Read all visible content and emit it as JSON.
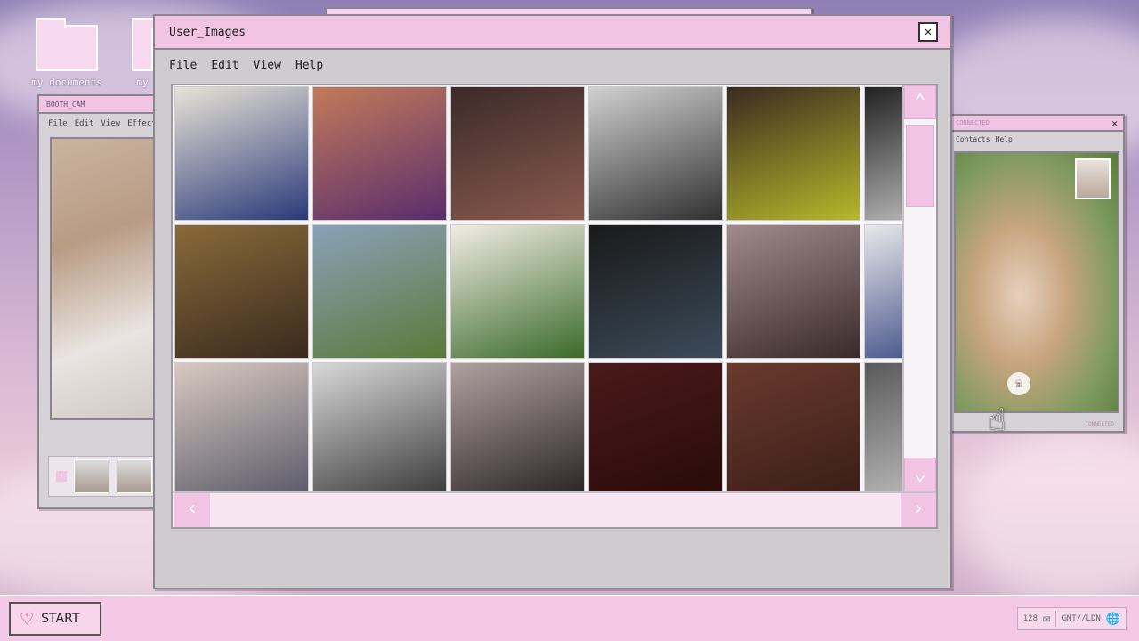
{
  "desktop": {
    "icons": [
      {
        "label": "my documents"
      },
      {
        "label": "my"
      }
    ]
  },
  "booth_window": {
    "title": "BOOTH_CAM",
    "menu": [
      "File",
      "Edit",
      "View",
      "Effects"
    ]
  },
  "contacts_window": {
    "title": "CONNECTED",
    "menu": [
      "Contacts",
      "Help"
    ],
    "status": "CONNECTED"
  },
  "main_window": {
    "title": "User_Images",
    "menu": [
      "File",
      "Edit",
      "View",
      "Help"
    ],
    "photos": [
      {
        "color_a": "#e8e2d6",
        "color_b": "#2a3a7a"
      },
      {
        "color_a": "#c27a5a",
        "color_b": "#5a2d6d"
      },
      {
        "color_a": "#3c2a2a",
        "color_b": "#8a5b4f"
      },
      {
        "color_a": "#d0d0d0",
        "color_b": "#303030"
      },
      {
        "color_a": "#3a2a20",
        "color_b": "#b5b82a"
      },
      {
        "color_a": "#222222",
        "color_b": "#cfcfcf"
      },
      {
        "color_a": "#8a6a3a",
        "color_b": "#3a2a1e"
      },
      {
        "color_a": "#8aa0b8",
        "color_b": "#5a7a3a"
      },
      {
        "color_a": "#f1ece4",
        "color_b": "#3a6a2a"
      },
      {
        "color_a": "#1a1a1a",
        "color_b": "#3c4b5a"
      },
      {
        "color_a": "#a08a8a",
        "color_b": "#3a2a2a"
      },
      {
        "color_a": "#e8e8ea",
        "color_b": "#2a3a7a"
      },
      {
        "color_a": "#d8c8c0",
        "color_b": "#5a5a6a"
      },
      {
        "color_a": "#d8d8d8",
        "color_b": "#3a3a3a"
      },
      {
        "color_a": "#b0a0a0",
        "color_b": "#2a2424"
      },
      {
        "color_a": "#4a1a1a",
        "color_b": "#2a0a0a"
      },
      {
        "color_a": "#6a3a2e",
        "color_b": "#3a1e18"
      },
      {
        "color_a": "#5a5a5a",
        "color_b": "#c8c8c8"
      }
    ]
  },
  "taskbar": {
    "start_label": "START",
    "tray_count": "128",
    "tray_zone": "GMT//LDN"
  },
  "colors": {
    "accent_pink": "#f1c4e4",
    "window_gray": "#cfcbcf"
  }
}
